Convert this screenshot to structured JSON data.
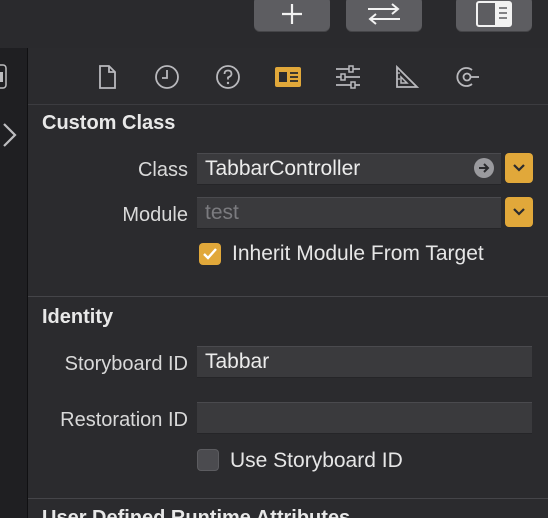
{
  "toolbar": {
    "buttons": [
      {
        "icon": "plus-icon"
      },
      {
        "icon": "swap-arrows-icon"
      },
      {
        "icon": "panel-right-icon"
      }
    ]
  },
  "left_strip": {
    "chevron_icon": "chevron-right-icon"
  },
  "inspector_tabs": [
    {
      "icon": "file-icon",
      "selected": false
    },
    {
      "icon": "clock-icon",
      "selected": false
    },
    {
      "icon": "help-icon",
      "selected": false
    },
    {
      "icon": "identity-card-icon",
      "selected": true
    },
    {
      "icon": "sliders-icon",
      "selected": false
    },
    {
      "icon": "ruler-icon",
      "selected": false
    },
    {
      "icon": "connections-icon",
      "selected": false
    }
  ],
  "custom_class": {
    "title": "Custom Class",
    "class_label": "Class",
    "class_value": "TabbarController",
    "module_label": "Module",
    "module_placeholder": "test",
    "inherit_label": "Inherit Module From Target",
    "inherit_checked": true
  },
  "identity": {
    "title": "Identity",
    "storyboard_id_label": "Storyboard ID",
    "storyboard_id_value": "Tabbar",
    "restoration_id_label": "Restoration ID",
    "restoration_id_value": "",
    "use_storyboard_label": "Use Storyboard ID",
    "use_storyboard_checked": false
  },
  "user_defined": {
    "title": "User Defined Runtime Attributes"
  },
  "colors": {
    "accent": "#e1a83a",
    "background": "#2b2b2e",
    "field": "#3a3a3d"
  }
}
